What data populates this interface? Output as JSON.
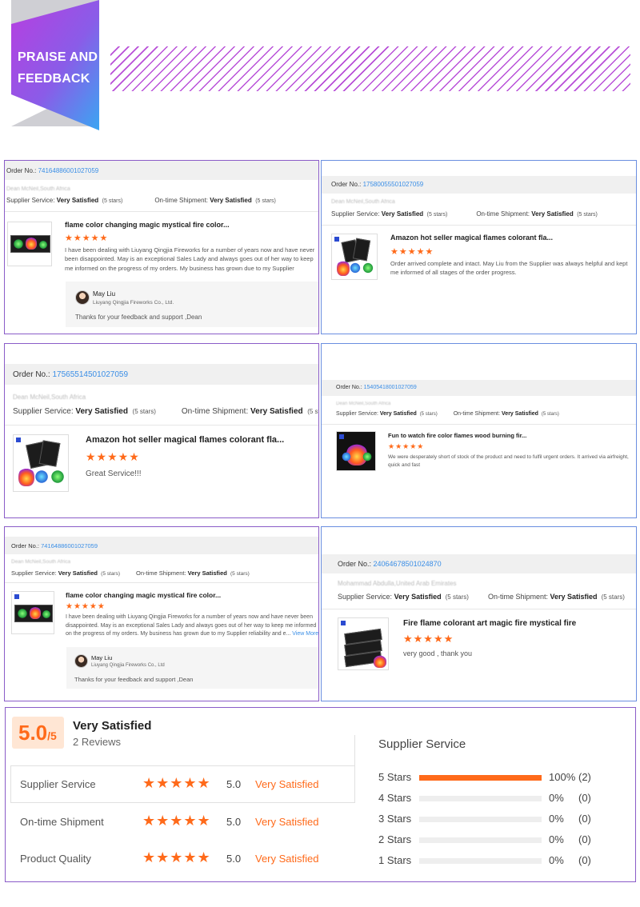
{
  "banner": {
    "title_line1": "PRAISE AND",
    "title_line2": "FEEDBACK"
  },
  "labels": {
    "order_no": "Order No.:",
    "supplier_service": "Supplier Service:",
    "ontime_shipment": "On-time Shipment:",
    "very_satisfied": "Very Satisfied",
    "five_stars": "(5 stars)",
    "view_more": "View More"
  },
  "cards": [
    {
      "order": "74164886001027059",
      "customer": "Dean McNeil,South Africa",
      "product": "flame color changing magic mystical fire color...",
      "rating": "★★★★★",
      "review": "I have been dealing with Liuyang Qingjia Fireworks for a number of years now and have never been disappointed. May is an exceptional Sales Lady and always goes out of her way to keep me informed on the progress of my orders. My business has grown due to my Supplier reliability and e...",
      "reply_name": "May Liu",
      "reply_company": "Liuyang Qingjia Fireworks Co., Ltd.",
      "reply_text": "Thanks for your feedback and support ,Dean"
    },
    {
      "order": "17580055501027059",
      "customer": "Dean McNeil,South Africa",
      "product": "Amazon hot seller magical flames colorant fla...",
      "rating": "★★★★★",
      "review": "Order arrived complete and intact. May Liu from the Supplier was always helpful and kept me informed of all stages of the order progress."
    },
    {
      "order": "17565514501027059",
      "customer": "Dean McNeil,South Africa",
      "product": "Amazon hot seller magical flames colorant fla...",
      "rating": "★★★★★",
      "review": "Great Service!!!"
    },
    {
      "order": "15405418001027059",
      "customer": "Dean McNeil,South Africa",
      "product": "Fun to watch fire color flames wood burning fir...",
      "rating": "★★★★★",
      "review": "We were desperately short of stock of the product and need to fulfil urgent orders. It arrived via airfreight, quick and fast"
    },
    {
      "order": "74164886001027059",
      "customer": "Dean McNeil,South Africa",
      "product": "flame color changing magic mystical fire color...",
      "rating": "★★★★★",
      "review": "I have been dealing with Liuyang Qingjia Fireworks for a number of years now and have never been disappointed. May is an exceptional Sales Lady and always goes out of her way to keep me informed on the progress of my orders. My business has grown due to my Supplier reliability and e...",
      "reply_name": "May Liu",
      "reply_company": "Liuyang Qingjia Fireworks Co., Ltd",
      "reply_text": "Thanks for your feedback and support ,Dean"
    },
    {
      "order": "24064678501024870",
      "customer": "Mohammad Abdulla,United Arab Emirates",
      "product": "Fire flame colorant art magic fire mystical fire",
      "rating": "★★★★★",
      "review": "very good , thank you"
    }
  ],
  "summary": {
    "score": "5.0",
    "score_max": "/5",
    "title": "Very Satisfied",
    "reviews": "2 Reviews",
    "rows": [
      {
        "label": "Supplier Service",
        "stars": "★★★★★",
        "value": "5.0",
        "text": "Very Satisfied"
      },
      {
        "label": "On-time Shipment",
        "stars": "★★★★★",
        "value": "5.0",
        "text": "Very Satisfied"
      },
      {
        "label": "Product Quality",
        "stars": "★★★★★",
        "value": "5.0",
        "text": "Very Satisfied"
      }
    ],
    "breakdown_title": "Supplier Service",
    "breakdown": [
      {
        "label": "5 Stars",
        "fraction": 1.0,
        "pct": "100%",
        "count": "(2)"
      },
      {
        "label": "4 Stars",
        "fraction": 0,
        "pct": "0%",
        "count": "(0)"
      },
      {
        "label": "3 Stars",
        "fraction": 0,
        "pct": "0%",
        "count": "(0)"
      },
      {
        "label": "2 Stars",
        "fraction": 0,
        "pct": "0%",
        "count": "(0)"
      },
      {
        "label": "1 Stars",
        "fraction": 0,
        "pct": "0%",
        "count": "(0)"
      }
    ]
  },
  "colors": {
    "accent": "#ff6a1a",
    "link": "#3a8ee6",
    "border_purple": "#8a5cc8",
    "banner_from": "#a03fe0",
    "banner_to": "#3fa0f0"
  }
}
